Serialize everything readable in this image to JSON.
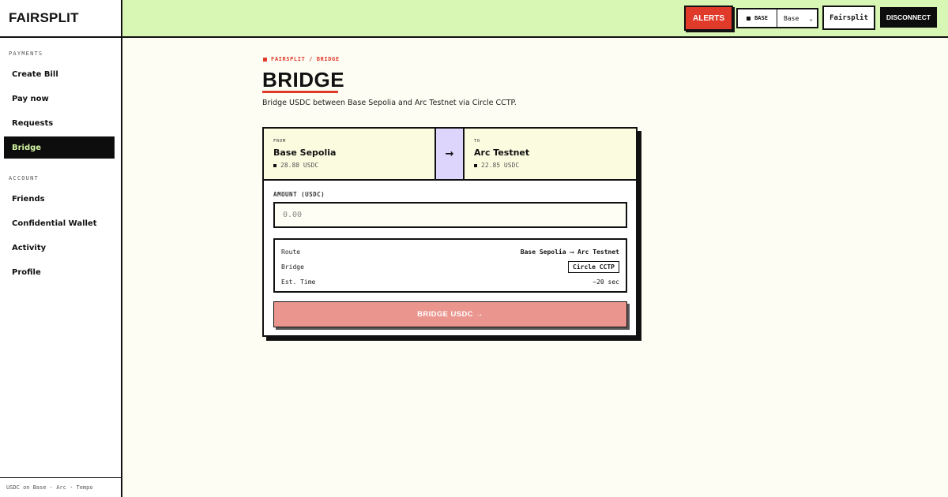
{
  "brand": "FAIRSPLIT",
  "sidebar": {
    "payments_label": "PAYMENTS",
    "payments": [
      {
        "label": "Create Bill"
      },
      {
        "label": "Pay now"
      },
      {
        "label": "Requests"
      },
      {
        "label": "Bridge",
        "active": true
      }
    ],
    "account_label": "ACCOUNT",
    "account": [
      {
        "label": "Friends"
      },
      {
        "label": "Confidential Wallet"
      },
      {
        "label": "Activity"
      },
      {
        "label": "Profile"
      }
    ],
    "footer": "USDC on Base · Arc · Tempo"
  },
  "header": {
    "alerts_label": "ALERTS",
    "chain_tag": "BASE",
    "chain_select": "Base",
    "user_label": "Fairsplit",
    "disconnect_label": "DISCONNECT"
  },
  "main": {
    "breadcrumb": "FAIRSPLIT / BRIDGE",
    "title": "BRIDGE",
    "subtitle": "Bridge USDC between Base Sepolia and Arc Testnet via Circle CCTP.",
    "from": {
      "label": "FROM",
      "name": "Base Sepolia",
      "balance": "28.88 USDC"
    },
    "to": {
      "label": "TO",
      "name": "Arc Testnet",
      "balance": "22.85 USDC"
    },
    "amount_label": "AMOUNT (USDC)",
    "amount_placeholder": "0.00",
    "details": {
      "route_key": "Route",
      "route_val": "Base Sepolia ⟶ Arc Testnet",
      "bridge_key": "Bridge",
      "bridge_val": "Circle CCTP",
      "time_key": "Est. Time",
      "time_val": "~20 sec"
    },
    "bridge_button": "BRIDGE USDC →"
  },
  "colors": {
    "accent_red": "#e03a2b",
    "header_green": "#d9f7b4",
    "active_text": "#d6f7a5",
    "arrow_purple": "#ddd5fb",
    "button_disabled": "#ea958e"
  }
}
